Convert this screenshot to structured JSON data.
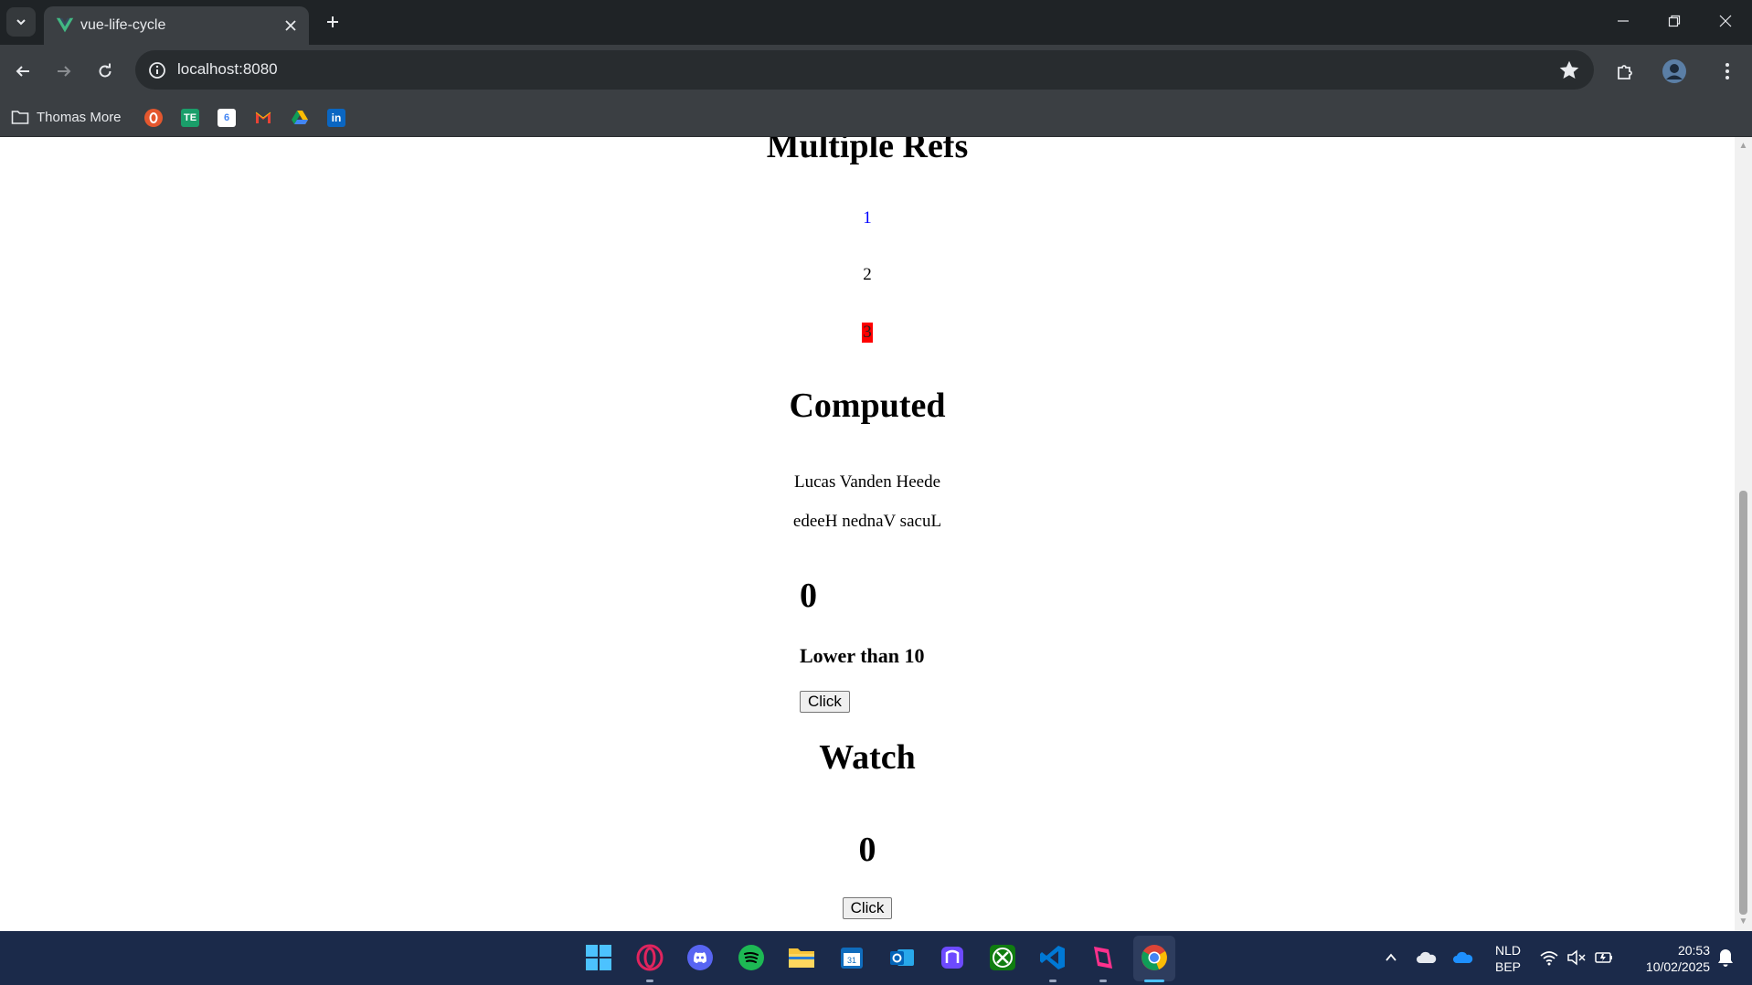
{
  "browser": {
    "tab_title": "vue-life-cycle",
    "url": "localhost:8080",
    "bookmarks": {
      "folder_label": "Thomas More",
      "icons": [
        "opera-icon",
        "te-icon",
        "google-calendar-icon",
        "gmail-icon",
        "google-drive-icon",
        "linkedin-icon"
      ]
    }
  },
  "page": {
    "multiple_refs": {
      "heading": "Multiple Refs",
      "items": [
        "1",
        "2",
        "3"
      ]
    },
    "computed": {
      "heading": "Computed",
      "full_name": "Lucas Vanden Heede",
      "reversed_name": "edeeH nednaV sacuL",
      "counter": "0",
      "status": "Lower than 10",
      "button_label": "Click"
    },
    "watch": {
      "heading": "Watch",
      "counter": "0",
      "button_label": "Click"
    }
  },
  "taskbar": {
    "language": "NLD",
    "keyboard": "BEP",
    "time": "20:53",
    "date": "10/02/2025"
  },
  "colors": {
    "chrome_dark": "#1f2326",
    "chrome_toolbar": "#3b3f43",
    "vue_green": "#42b883",
    "ref_blue": "#0000ff",
    "ref_red": "#ff0000",
    "taskbar": "#1b2a4a"
  }
}
